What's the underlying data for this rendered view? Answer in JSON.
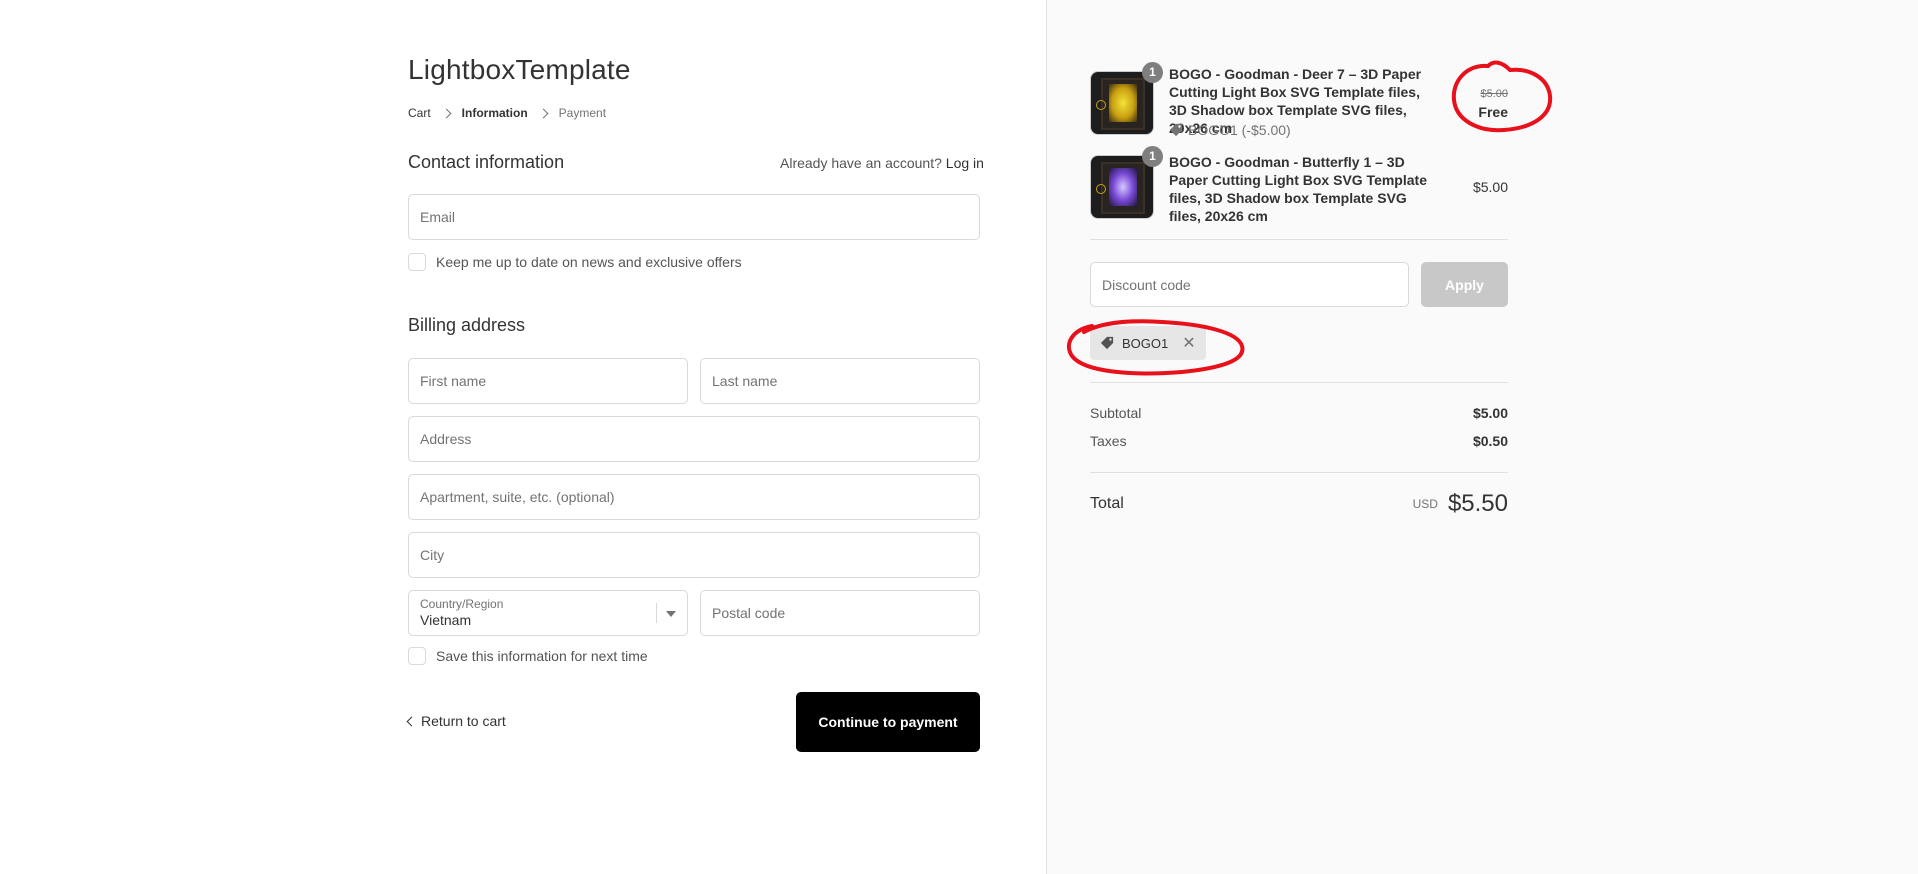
{
  "shop": {
    "title": "LightboxTemplate"
  },
  "breadcrumb": {
    "cart": "Cart",
    "information": "Information",
    "payment": "Payment"
  },
  "contact": {
    "heading": "Contact information",
    "account_prompt": "Already have an account?",
    "login_link": "Log in",
    "email_placeholder": "Email",
    "newsletter_label": "Keep me up to date on news and exclusive offers"
  },
  "billing": {
    "heading": "Billing address",
    "first_name_placeholder": "First name",
    "last_name_placeholder": "Last name",
    "address_placeholder": "Address",
    "apartment_placeholder": "Apartment, suite, etc. (optional)",
    "city_placeholder": "City",
    "country_label": "Country/Region",
    "country_value": "Vietnam",
    "postal_placeholder": "Postal code",
    "save_label": "Save this information for next time"
  },
  "actions": {
    "return_to_cart": "Return to cart",
    "continue": "Continue to payment"
  },
  "order": {
    "items": [
      {
        "quantity": "1",
        "title": "BOGO - Goodman - Deer 7 – 3D Paper Cutting Light Box SVG Template files, 3D Shadow box Template SVG files, 20x26 cm",
        "discount": "BOGO1 (-$5.00)",
        "price_original": "$5.00",
        "price": "Free"
      },
      {
        "quantity": "1",
        "title": "BOGO - Goodman - Butterfly 1 – 3D Paper Cutting Light Box SVG Template files, 3D Shadow box Template SVG files, 20x26 cm",
        "price": "$5.00"
      }
    ],
    "discount_placeholder": "Discount code",
    "apply_label": "Apply",
    "applied_code": "BOGO1",
    "remove_symbol": "✕",
    "subtotal_label": "Subtotal",
    "subtotal_value": "$5.00",
    "taxes_label": "Taxes",
    "taxes_value": "$0.50",
    "total_label": "Total",
    "currency": "USD",
    "total_value": "$5.50"
  },
  "colors": {
    "annotation": "#e8101b",
    "button": "#000000",
    "apply_disabled": "#c8c8c8"
  }
}
